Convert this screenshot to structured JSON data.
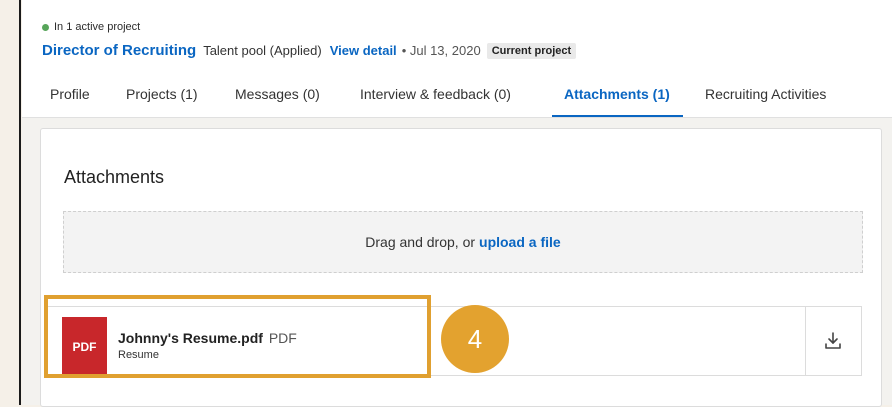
{
  "header": {
    "status": "In 1 active project",
    "job_title": "Director of Recruiting",
    "pool": "Talent pool (Applied)",
    "view_detail": "View detail",
    "date": "• Jul 13, 2020",
    "badge": "Current project"
  },
  "tabs": [
    {
      "label": "Profile",
      "active": false
    },
    {
      "label": "Projects (1)",
      "active": false
    },
    {
      "label": "Messages (0)",
      "active": false
    },
    {
      "label": "Interview & feedback (0)",
      "active": false
    },
    {
      "label": "Attachments (1)",
      "active": true
    },
    {
      "label": "Recruiting Activities",
      "active": false
    }
  ],
  "attachments": {
    "title": "Attachments",
    "dropzone_text": "Drag and drop, or",
    "upload_link": "upload a file",
    "file": {
      "icon_label": "PDF",
      "name": "Johnny's Resume.pdf",
      "type": "PDF",
      "category": "Resume",
      "icon": "download-icon"
    }
  },
  "annotation": {
    "marker": "4"
  },
  "colors": {
    "accent": "#0a66c2",
    "highlight": "#e0a030",
    "marker": "#e3a22f",
    "pdf": "#c8272b",
    "status_dot": "#57a55a"
  }
}
